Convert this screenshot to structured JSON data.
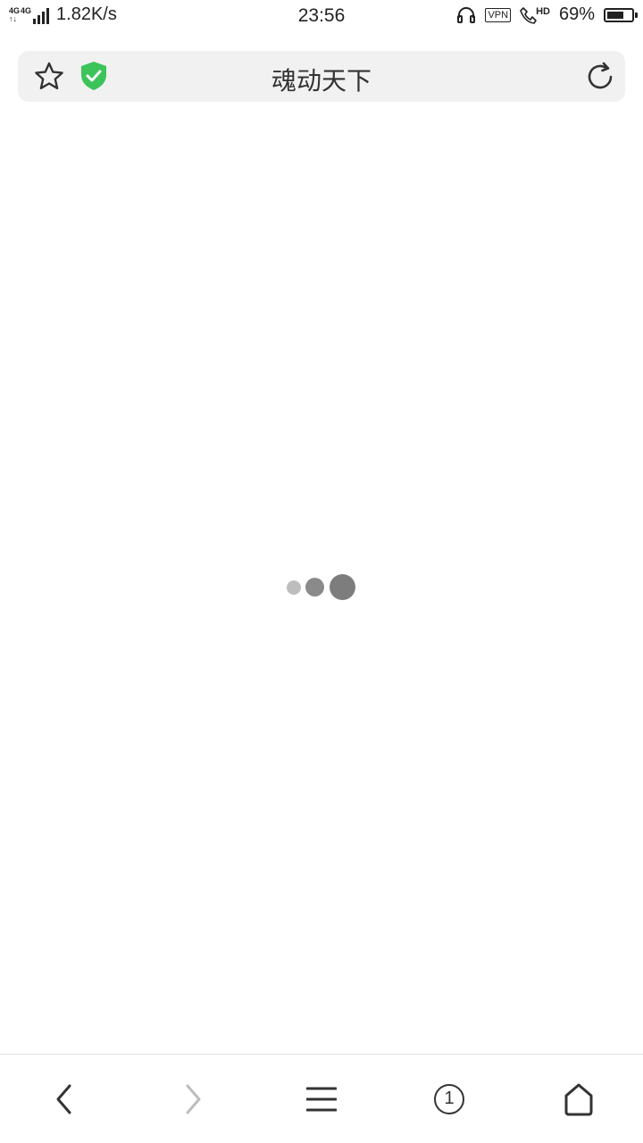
{
  "status_bar": {
    "network_type_1": "4G",
    "network_type_2": "4G",
    "net_speed": "1.82K/s",
    "time": "23:56",
    "vpn_label": "VPN",
    "hd_label": "HD",
    "battery_percent": "69%",
    "battery_level": 0.69
  },
  "address_bar": {
    "page_title": "魂动天下",
    "shield_color": "#3cc45a"
  },
  "toolbar": {
    "tab_count": "1"
  }
}
